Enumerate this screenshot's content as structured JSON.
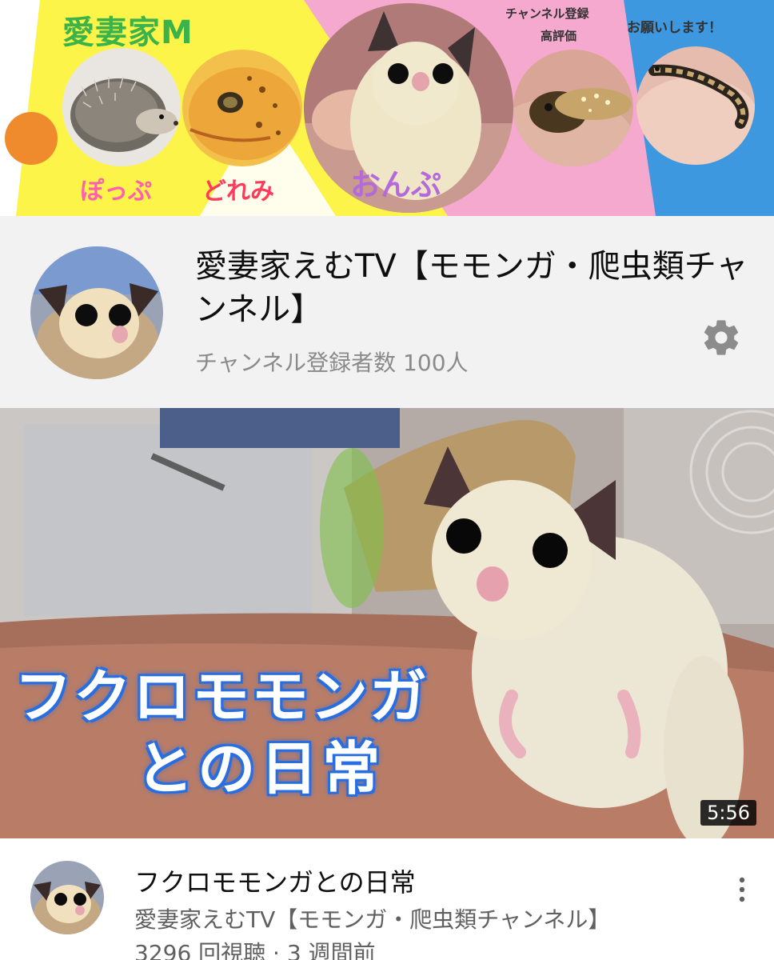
{
  "banner": {
    "family_tag": "愛妻家M",
    "subscribe_text": "チャンネル登録",
    "rate_text": "高評価",
    "please_text": "お願いします！",
    "pet_names": [
      "ぽっぷ",
      "どれみ",
      "おんぷ"
    ],
    "colors": {
      "yellow": "#fdf44a",
      "pink": "#f6a9cf",
      "blue": "#3d98e0",
      "orange_dot": "#ef8a2d"
    }
  },
  "channel": {
    "title": "愛妻家えむTV【モモンガ・爬虫類チャンネル】",
    "subscribers": "チャンネル登録者数 100人",
    "settings_icon": "gear-icon"
  },
  "video": {
    "thumbnail_caption_line1": "フクロモモンガ",
    "thumbnail_caption_line2": "との日常",
    "duration": "5:56",
    "title": "フクロモモンガとの日常",
    "channel_name": "愛妻家えむTV【モモンガ・爬虫類チャンネル】",
    "stats": "3296 回視聴 · 3 週間前",
    "more_icon": "more-vertical-icon"
  }
}
